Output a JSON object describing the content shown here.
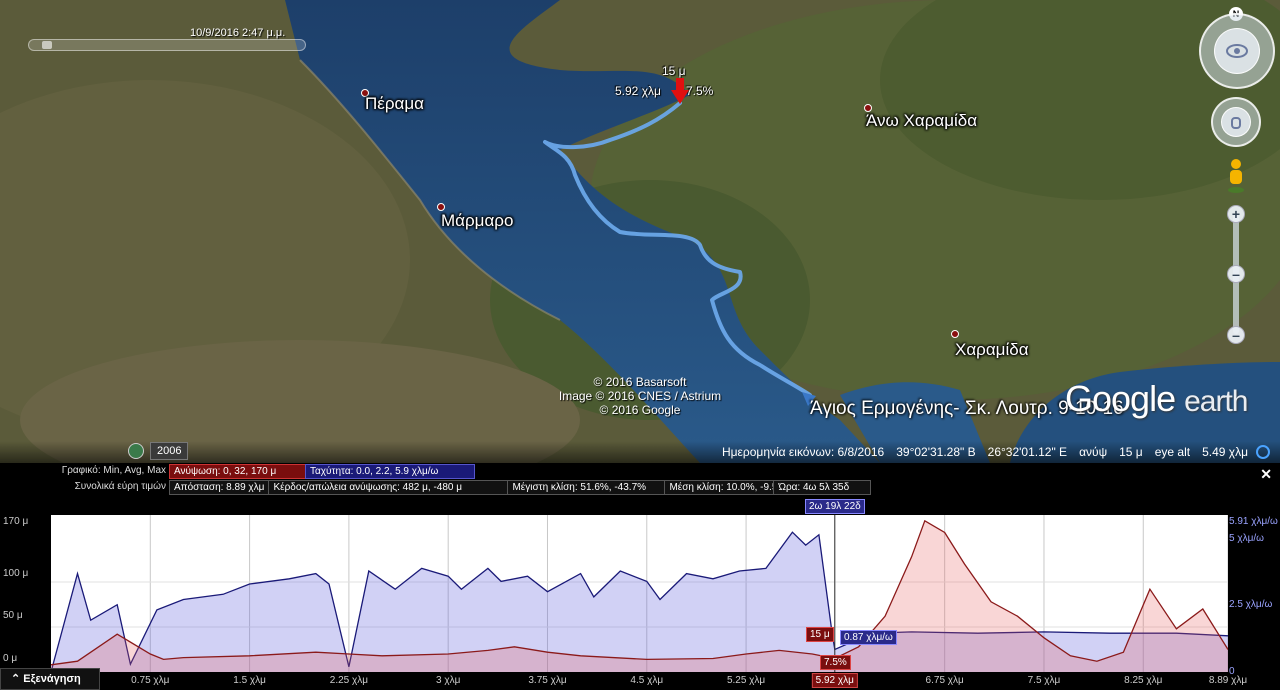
{
  "map": {
    "time_label": "10/9/2016   2:47 μ.μ.",
    "places": [
      "Πέραμα",
      "Μάρμαρο",
      "Άνω Χαραμίδα",
      "Χαραμίδα"
    ],
    "track_title": "Άγιος Ερμογένης- Σκ. Λουτρ. 9-10-16",
    "marker": {
      "elevation": "15 μ",
      "distance": "5.92 χλμ",
      "slope": "7.5%"
    },
    "credits": [
      "© 2016 Basarsoft",
      "Image © 2016 CNES / Astrium",
      "© 2016 Google"
    ],
    "brand": "Google",
    "brand_suffix": "earth",
    "history_year": "2006",
    "compass_letter": "N",
    "icons": [
      "look-joystick-icon",
      "move-joystick-icon",
      "street-view-pegman-icon",
      "zoom-in-icon",
      "zoom-out-icon",
      "historical-imagery-clock-icon",
      "streaming-indicator-icon"
    ]
  },
  "statusbar": {
    "imagery_date": "Ημερομηνία εικόνων: 6/8/2016",
    "lat": "39°02'31.28\" Β",
    "lon": "26°32'01.12\" Ε",
    "elev_label": "ανύψ",
    "elev_value": "15 μ",
    "eye_alt": "eye alt",
    "eye_alt_value": "5.49 χλμ"
  },
  "profile": {
    "row1_label": "Γραφικό: Min, Avg, Max",
    "elevation_stat": "Ανύψωση: 0, 32, 170 μ",
    "speed_stat": "Ταχύτητα: 0.0, 2.2, 5.9 χλμ/ω",
    "row2_label": "Συνολικά εύρη τιμών",
    "distance": "Απόσταση: 8.89 χλμ",
    "gain_loss": "Κέρδος/απώλεια ανύψωσης: 482 μ, -480 μ",
    "max_slope": "Μέγιστη κλίση: 51.6%, -43.7%",
    "avg_slope": "Μέση κλίση: 10.0%, -9.5%",
    "time": "Ώρα: 4ω 5λ 35δ",
    "explore_label": "Εξενάγηση",
    "close": "✕",
    "time_flag": "2ω 19λ 22δ",
    "cursor_elev": "15 μ",
    "cursor_speed": "0.87 χλμ/ω",
    "cursor_slope": "7.5%",
    "colors": {
      "elevation": "#8b1a1a",
      "speed": "#1a1a78"
    }
  },
  "chart_data": {
    "type": "area",
    "xlabel": "",
    "ylabel": "",
    "x_ticks": [
      "0.75 χλμ",
      "1.5 χλμ",
      "2.25 χλμ",
      "3 χλμ",
      "3.75 χλμ",
      "4.5 χλμ",
      "5.25 χλμ",
      "5.92 χλμ",
      "6.75 χλμ",
      "7.5 χλμ",
      "8.25 χλμ",
      "8.89 χλμ"
    ],
    "x_tick_values": [
      0.75,
      1.5,
      2.25,
      3,
      3.75,
      4.5,
      5.25,
      5.92,
      6.75,
      7.5,
      8.25,
      8.89
    ],
    "y_left_ticks": [
      "170 μ",
      "100 μ",
      "50 μ",
      "0 μ"
    ],
    "y_left_values": [
      170,
      100,
      50,
      0
    ],
    "y_right_ticks": [
      "5.91 χλμ/ω",
      "5 χλμ/ω",
      "2.5 χλμ/ω",
      "0"
    ],
    "y_right_values": [
      5.91,
      5,
      2.5,
      0
    ],
    "xlim": [
      0,
      8.89
    ],
    "ylim_left": [
      0,
      170
    ],
    "ylim_right": [
      0,
      5.91
    ],
    "series": [
      {
        "name": "Ανύψωση",
        "axis": "left",
        "x": [
          0,
          0.2,
          0.5,
          0.75,
          0.85,
          1.0,
          1.5,
          2.0,
          2.25,
          2.5,
          3.0,
          3.3,
          3.5,
          3.75,
          4.0,
          4.5,
          5.0,
          5.25,
          5.5,
          5.75,
          5.92,
          6.1,
          6.3,
          6.5,
          6.6,
          6.75,
          6.9,
          7.1,
          7.3,
          7.5,
          7.7,
          7.9,
          8.1,
          8.3,
          8.5,
          8.7,
          8.89
        ],
        "values": [
          8,
          12,
          42,
          20,
          14,
          16,
          18,
          22,
          20,
          18,
          20,
          24,
          28,
          22,
          18,
          14,
          15,
          20,
          24,
          20,
          15,
          28,
          62,
          128,
          168,
          155,
          120,
          78,
          62,
          38,
          18,
          12,
          22,
          92,
          48,
          70,
          25
        ]
      },
      {
        "name": "Ταχύτητα",
        "axis": "right",
        "x": [
          0,
          0.2,
          0.3,
          0.5,
          0.6,
          0.8,
          1.0,
          1.3,
          1.5,
          1.8,
          2.0,
          2.1,
          2.25,
          2.4,
          2.6,
          2.8,
          3.0,
          3.1,
          3.3,
          3.4,
          3.6,
          3.75,
          4.0,
          4.1,
          4.3,
          4.5,
          4.6,
          4.8,
          5.0,
          5.2,
          5.4,
          5.6,
          5.7,
          5.8,
          5.9,
          5.92,
          6.2,
          6.5,
          7.0,
          7.5,
          8.0,
          8.5,
          8.89
        ],
        "values": [
          0,
          3.8,
          2.0,
          2.6,
          0.3,
          2.4,
          2.8,
          3.0,
          3.4,
          3.6,
          3.8,
          3.4,
          0.2,
          3.9,
          3.2,
          4.0,
          3.7,
          3.2,
          4.0,
          3.5,
          3.7,
          3.1,
          3.8,
          2.9,
          3.9,
          3.5,
          2.8,
          3.8,
          3.6,
          3.9,
          4.0,
          5.4,
          4.9,
          5.3,
          1.5,
          0.87,
          1.5,
          1.55,
          1.5,
          1.55,
          1.5,
          1.5,
          1.4
        ]
      }
    ],
    "cursor_x": 5.92,
    "grid": true
  }
}
